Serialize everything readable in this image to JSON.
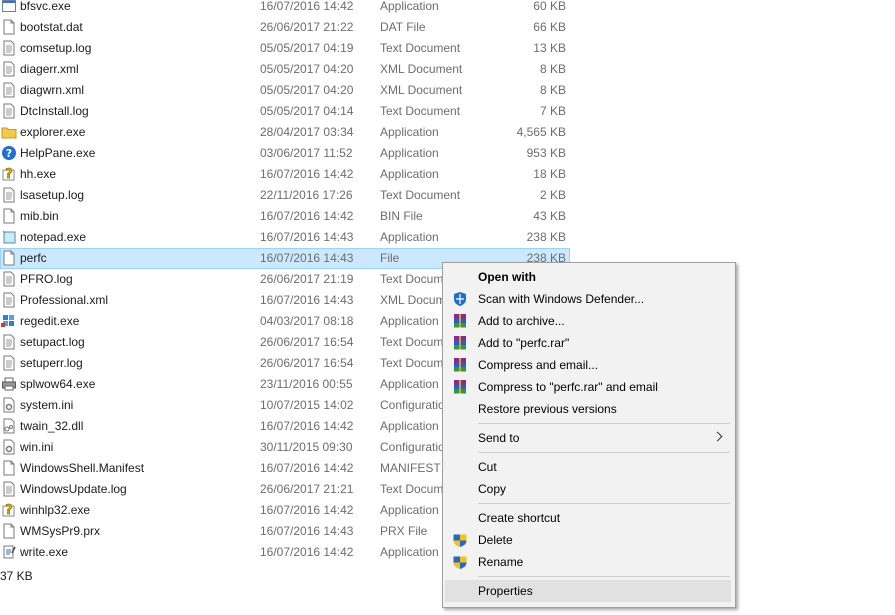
{
  "files": [
    {
      "name": "bfsvc.exe",
      "date": "16/07/2016 14:42",
      "type": "Application",
      "size": "60 KB",
      "icon": "app-icon"
    },
    {
      "name": "bootstat.dat",
      "date": "26/06/2017 21:22",
      "type": "DAT File",
      "size": "66 KB",
      "icon": "file-icon"
    },
    {
      "name": "comsetup.log",
      "date": "05/05/2017 04:19",
      "type": "Text Document",
      "size": "13 KB",
      "icon": "text-icon"
    },
    {
      "name": "diagerr.xml",
      "date": "05/05/2017 04:20",
      "type": "XML Document",
      "size": "8 KB",
      "icon": "text-icon"
    },
    {
      "name": "diagwrn.xml",
      "date": "05/05/2017 04:20",
      "type": "XML Document",
      "size": "8 KB",
      "icon": "text-icon"
    },
    {
      "name": "DtcInstall.log",
      "date": "05/05/2017 04:14",
      "type": "Text Document",
      "size": "7 KB",
      "icon": "text-icon"
    },
    {
      "name": "explorer.exe",
      "date": "28/04/2017 03:34",
      "type": "Application",
      "size": "4,565 KB",
      "icon": "folder-icon"
    },
    {
      "name": "HelpPane.exe",
      "date": "03/06/2017 11:52",
      "type": "Application",
      "size": "953 KB",
      "icon": "help-icon"
    },
    {
      "name": "hh.exe",
      "date": "16/07/2016 14:42",
      "type": "Application",
      "size": "18 KB",
      "icon": "help-question-icon"
    },
    {
      "name": "lsasetup.log",
      "date": "22/11/2016 17:26",
      "type": "Text Document",
      "size": "2 KB",
      "icon": "text-icon"
    },
    {
      "name": "mib.bin",
      "date": "16/07/2016 14:42",
      "type": "BIN File",
      "size": "43 KB",
      "icon": "file-icon"
    },
    {
      "name": "notepad.exe",
      "date": "16/07/2016 14:43",
      "type": "Application",
      "size": "238 KB",
      "icon": "notepad-icon"
    },
    {
      "name": "perfc",
      "date": "16/07/2016 14:43",
      "type": "File",
      "size": "238 KB",
      "icon": "file-icon"
    },
    {
      "name": "PFRO.log",
      "date": "26/06/2017 21:19",
      "type": "Text Docum",
      "size": "",
      "icon": "text-icon"
    },
    {
      "name": "Professional.xml",
      "date": "16/07/2016 14:43",
      "type": "XML Docum",
      "size": "",
      "icon": "text-icon"
    },
    {
      "name": "regedit.exe",
      "date": "04/03/2017 08:18",
      "type": "Application",
      "size": "",
      "icon": "regedit-icon"
    },
    {
      "name": "setupact.log",
      "date": "26/06/2017 16:54",
      "type": "Text Docum",
      "size": "",
      "icon": "text-icon"
    },
    {
      "name": "setuperr.log",
      "date": "26/06/2017 16:54",
      "type": "Text Docum",
      "size": "",
      "icon": "text-icon"
    },
    {
      "name": "splwow64.exe",
      "date": "23/11/2016 00:55",
      "type": "Application",
      "size": "",
      "icon": "printer-icon"
    },
    {
      "name": "system.ini",
      "date": "10/07/2015 14:02",
      "type": "Configuratio",
      "size": "",
      "icon": "config-icon"
    },
    {
      "name": "twain_32.dll",
      "date": "16/07/2016 14:42",
      "type": "Application",
      "size": "",
      "icon": "dll-icon"
    },
    {
      "name": "win.ini",
      "date": "30/11/2015 09:30",
      "type": "Configuratio",
      "size": "",
      "icon": "config-icon"
    },
    {
      "name": "WindowsShell.Manifest",
      "date": "16/07/2016 14:42",
      "type": "MANIFEST F",
      "size": "",
      "icon": "file-icon"
    },
    {
      "name": "WindowsUpdate.log",
      "date": "26/06/2017 21:21",
      "type": "Text Docum",
      "size": "",
      "icon": "text-icon"
    },
    {
      "name": "winhlp32.exe",
      "date": "16/07/2016 14:42",
      "type": "Application",
      "size": "",
      "icon": "help-question-icon"
    },
    {
      "name": "WMSysPr9.prx",
      "date": "16/07/2016 14:43",
      "type": "PRX File",
      "size": "",
      "icon": "file-icon"
    },
    {
      "name": "write.exe",
      "date": "16/07/2016 14:42",
      "type": "Application",
      "size": "",
      "icon": "write-icon"
    }
  ],
  "selected_file": "perfc",
  "status": {
    "size_text": "37 KB"
  },
  "context_menu": {
    "items": [
      {
        "label": "Open with",
        "bold": true,
        "icon": ""
      },
      {
        "label": "Scan with Windows Defender...",
        "icon": "windows-defender-icon"
      },
      {
        "label": "Add to archive...",
        "icon": "winrar-icon"
      },
      {
        "label": "Add to \"perfc.rar\"",
        "icon": "winrar-icon"
      },
      {
        "label": "Compress and email...",
        "icon": "winrar-icon"
      },
      {
        "label": "Compress to \"perfc.rar\" and email",
        "icon": "winrar-icon"
      },
      {
        "label": "Restore previous versions",
        "icon": ""
      },
      {
        "separator": true
      },
      {
        "label": "Send to",
        "icon": "",
        "submenu": true
      },
      {
        "separator": true
      },
      {
        "label": "Cut",
        "icon": ""
      },
      {
        "label": "Copy",
        "icon": ""
      },
      {
        "separator": true
      },
      {
        "label": "Create shortcut",
        "icon": ""
      },
      {
        "label": "Delete",
        "icon": "shield-icon"
      },
      {
        "label": "Rename",
        "icon": "shield-icon"
      },
      {
        "separator": true
      },
      {
        "label": "Properties",
        "icon": "",
        "hover": true
      }
    ]
  },
  "colors": {
    "selection": "#cce8ff",
    "menu_bg": "#f2f2f2",
    "menu_hover": "#e1e1e1",
    "secondary_text": "#6d6d6d"
  }
}
